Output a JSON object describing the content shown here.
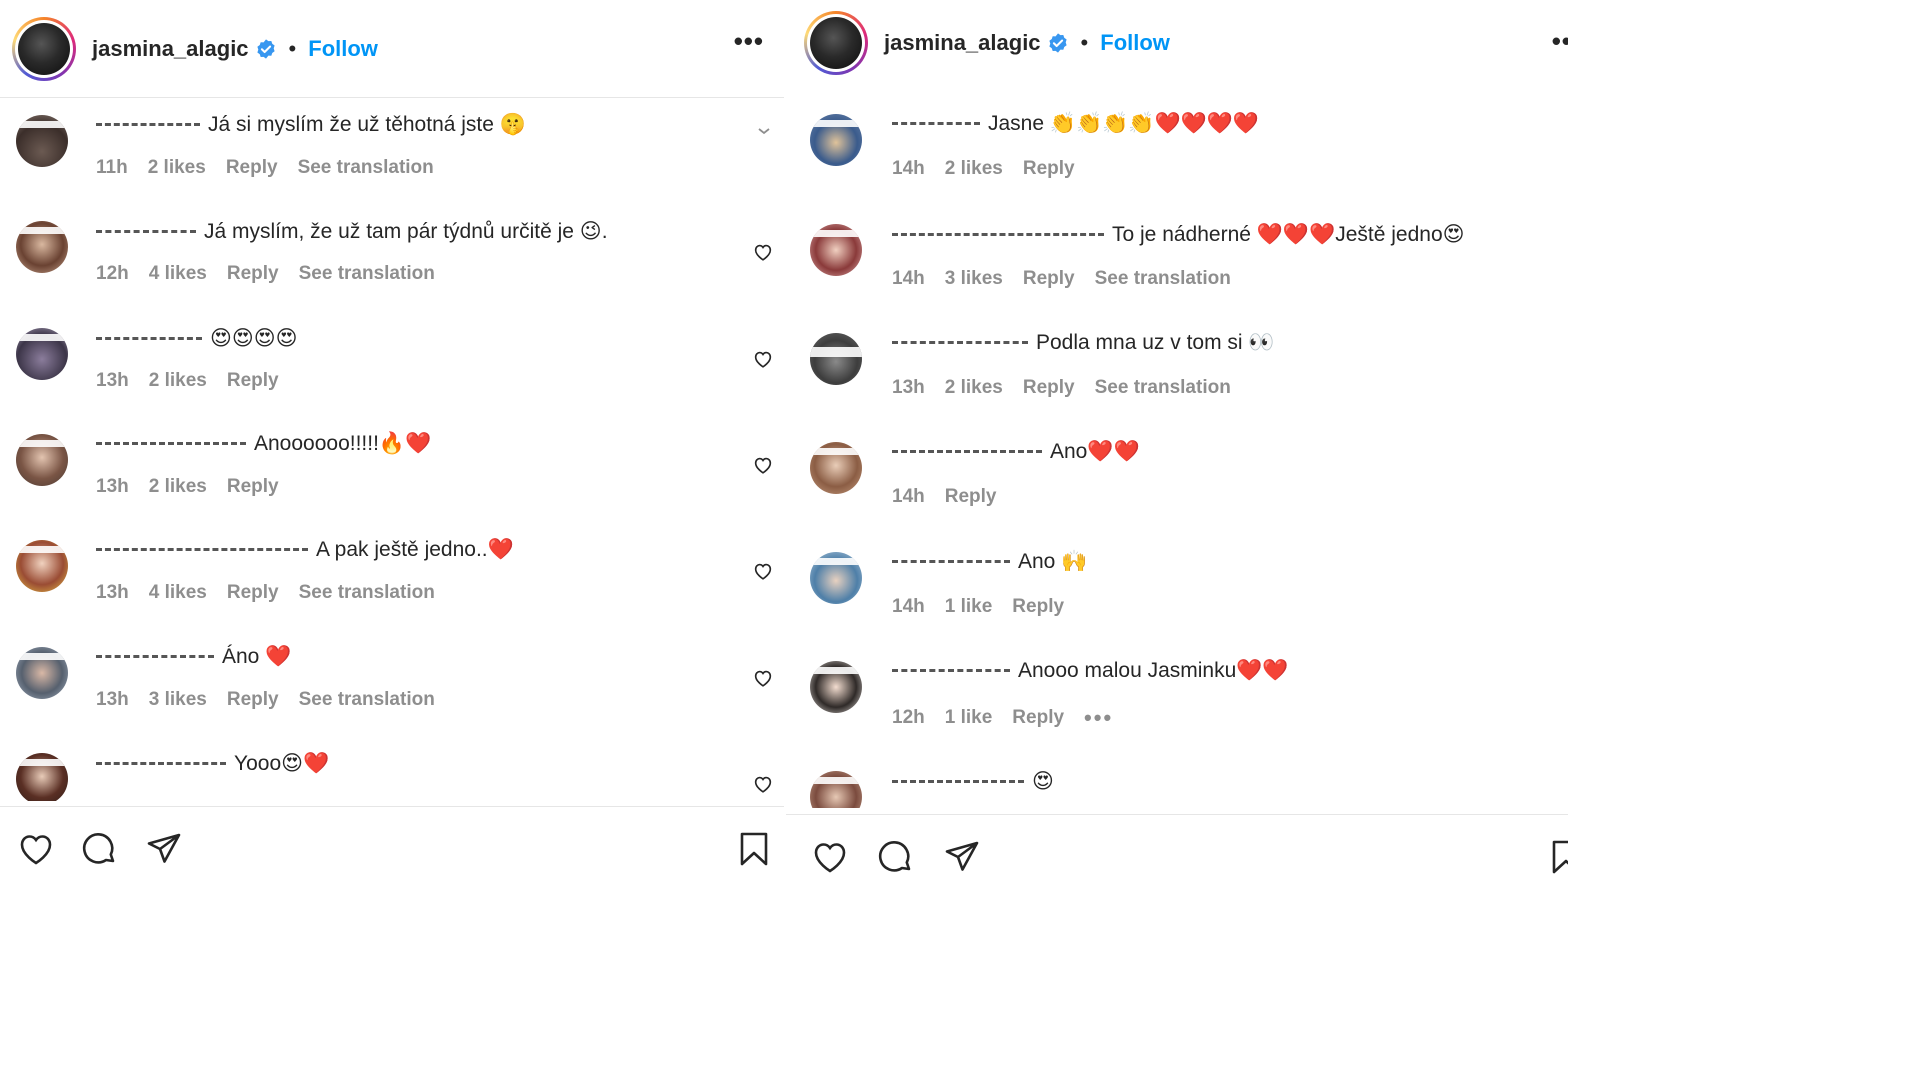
{
  "left": {
    "header": {
      "username": "jasmina_alagic",
      "separator": "•",
      "follow_label": "Follow",
      "more_label": "•••"
    },
    "comments": [
      {
        "text": "Já si myslím že už těhotná jste 🤫",
        "time": "11h",
        "likes": "2 likes",
        "reply": "Reply",
        "translate": "See translation"
      },
      {
        "text": "Já myslím, že už tam pár týdnů určitě je 😉.",
        "time": "12h",
        "likes": "4 likes",
        "reply": "Reply",
        "translate": "See translation"
      },
      {
        "text": "😍😍😍😍",
        "time": "13h",
        "likes": "2 likes",
        "reply": "Reply"
      },
      {
        "text": "Anoooooo!!!!!🔥❤️",
        "time": "13h",
        "likes": "2 likes",
        "reply": "Reply"
      },
      {
        "text": "A pak ještě jedno..❤️",
        "time": "13h",
        "likes": "4 likes",
        "reply": "Reply",
        "translate": "See translation"
      },
      {
        "text": "Áno ❤️",
        "time": "13h",
        "likes": "3 likes",
        "reply": "Reply",
        "translate": "See translation"
      },
      {
        "text": "Yooo😍❤️"
      }
    ]
  },
  "right": {
    "header": {
      "username": "jasmina_alagic",
      "separator": "•",
      "follow_label": "Follow",
      "more_label": "•••"
    },
    "comments": [
      {
        "text": "Jasne 👏👏👏👏❤️❤️❤️❤️",
        "time": "14h",
        "likes": "2 likes",
        "reply": "Reply"
      },
      {
        "text": "To je nádherné ❤️❤️❤️Ještě jedno😍",
        "time": "14h",
        "likes": "3 likes",
        "reply": "Reply",
        "translate": "See translation"
      },
      {
        "text": "Podla mna uz v tom si 👀",
        "time": "13h",
        "likes": "2 likes",
        "reply": "Reply",
        "translate": "See translation"
      },
      {
        "text": "Ano❤️❤️",
        "time": "14h",
        "reply": "Reply"
      },
      {
        "text": "Ano 🙌",
        "time": "14h",
        "likes": "1 like",
        "reply": "Reply"
      },
      {
        "text": "Anooo malou Jasminku❤️❤️",
        "time": "12h",
        "likes": "1 like",
        "reply": "Reply",
        "more": "•••"
      },
      {
        "text": "😍"
      }
    ]
  },
  "icons": {
    "verified": "verified-badge-icon",
    "heart": "heart-icon",
    "comment": "comment-icon",
    "share": "share-icon",
    "bookmark": "bookmark-icon",
    "chevron": "chevron-down-icon"
  },
  "colors": {
    "link": "#0095f6",
    "meta": "#8e8e8e",
    "text": "#262626"
  }
}
